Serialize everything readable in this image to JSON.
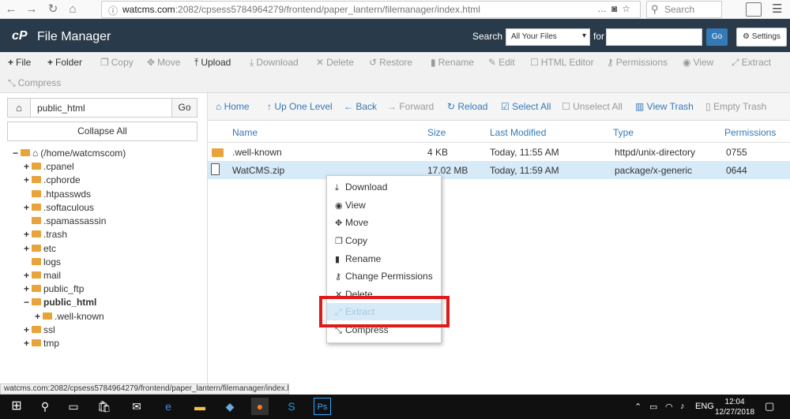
{
  "browser": {
    "url_domain": "watcms.com",
    "url_path": ":2082/cpsess5784964279/frontend/paper_lantern/filemanager/index.html",
    "search_placeholder": "Search",
    "more_icon": "…",
    "status_url": "watcms.com:2082/cpsess5784964279/frontend/paper_lantern/filemanager/index.html#"
  },
  "header": {
    "logo": "cP",
    "title": "File Manager",
    "search_label": "Search",
    "search_scope": "All Your Files",
    "for_label": "for",
    "go_label": "Go",
    "settings_label": "Settings"
  },
  "toolbar": {
    "file": "File",
    "folder": "Folder",
    "copy": "Copy",
    "move": "Move",
    "upload": "Upload",
    "download": "Download",
    "delete": "Delete",
    "restore": "Restore",
    "rename": "Rename",
    "edit": "Edit",
    "html_editor": "HTML Editor",
    "permissions": "Permissions",
    "view": "View",
    "extract": "Extract",
    "compress": "Compress"
  },
  "left_pane": {
    "path_value": "public_html",
    "go_label": "Go",
    "collapse_label": "Collapse All",
    "root": "(/home/watcmscom)",
    "tree": [
      {
        "label": ".cpanel",
        "pm": "+"
      },
      {
        "label": ".cphorde",
        "pm": "+"
      },
      {
        "label": ".htpasswds",
        "pm": ""
      },
      {
        "label": ".softaculous",
        "pm": "+"
      },
      {
        "label": ".spamassassin",
        "pm": ""
      },
      {
        "label": ".trash",
        "pm": "+"
      },
      {
        "label": "etc",
        "pm": "+"
      },
      {
        "label": "logs",
        "pm": ""
      },
      {
        "label": "mail",
        "pm": "+"
      },
      {
        "label": "public_ftp",
        "pm": "+"
      },
      {
        "label": "public_html",
        "pm": "−"
      },
      {
        "label": ".well-known",
        "pm": "+"
      },
      {
        "label": "ssl",
        "pm": "+"
      },
      {
        "label": "tmp",
        "pm": "+"
      }
    ]
  },
  "nav": {
    "home": "Home",
    "up": "Up One Level",
    "back": "Back",
    "forward": "Forward",
    "reload": "Reload",
    "select_all": "Select All",
    "unselect_all": "Unselect All",
    "view_trash": "View Trash",
    "empty_trash": "Empty Trash"
  },
  "table": {
    "columns": [
      "Name",
      "Size",
      "Last Modified",
      "Type",
      "Permissions"
    ],
    "rows": [
      {
        "name": ".well-known",
        "size": "4 KB",
        "modified": "Today, 11:55 AM",
        "type": "httpd/unix-directory",
        "perms": "0755"
      },
      {
        "name": "WatCMS.zip",
        "size": "17.02 MB",
        "modified": "Today, 11:59 AM",
        "type": "package/x-generic",
        "perms": "0644"
      }
    ]
  },
  "context_menu": {
    "items": [
      "Download",
      "View",
      "Move",
      "Copy",
      "Rename",
      "Change Permissions",
      "Delete",
      "Extract",
      "Compress"
    ]
  },
  "taskbar": {
    "lang": "ENG",
    "time": "12:04",
    "date": "12/27/2018"
  },
  "colors": {
    "header_bg": "#293a4a",
    "link": "#337ab7",
    "highlight": "#e01919",
    "selected_row": "#d6eaf8",
    "folder": "#e8a33b"
  }
}
